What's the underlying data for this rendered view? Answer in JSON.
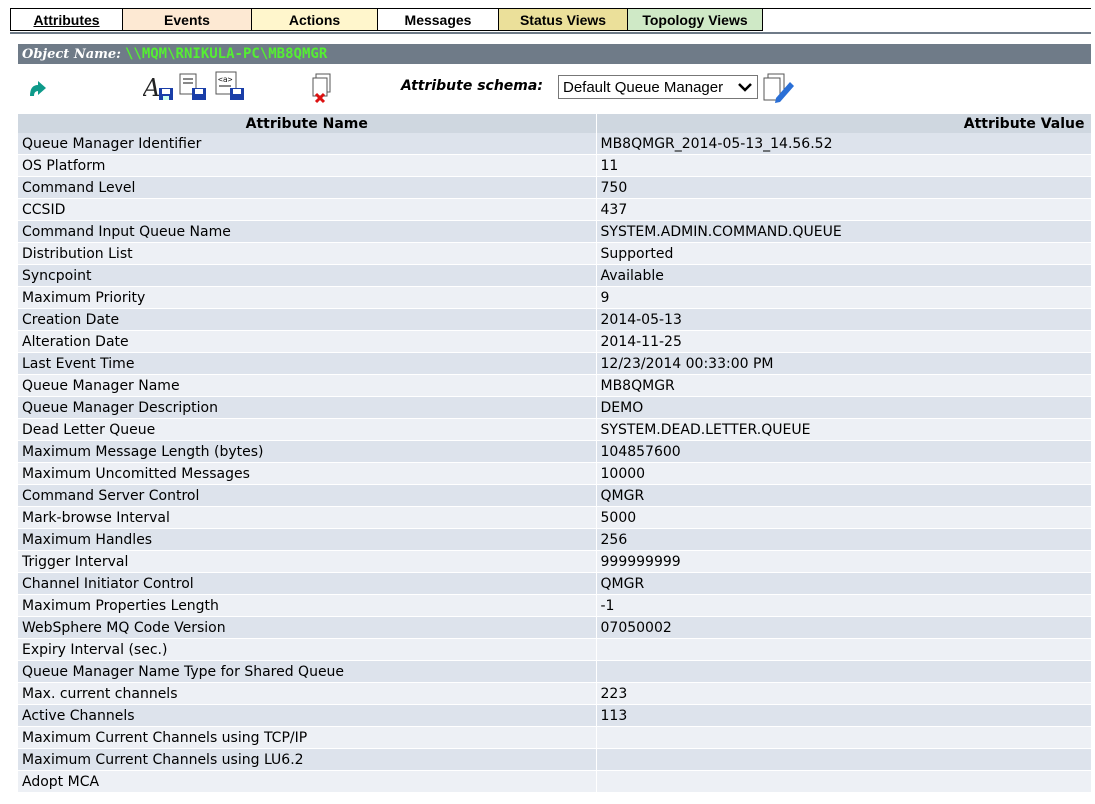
{
  "tabs": [
    {
      "label": "Attributes",
      "bg": "#ffffff",
      "active": true
    },
    {
      "label": "Events",
      "bg": "#fde9d3"
    },
    {
      "label": "Actions",
      "bg": "#fff6cc"
    },
    {
      "label": "Messages",
      "bg": "#ffffff"
    },
    {
      "label": "Status Views",
      "bg": "#ebe09a"
    },
    {
      "label": "Topology Views",
      "bg": "#cfe9c6"
    }
  ],
  "header": {
    "label": "Object Name:",
    "value": "\\\\MQM\\RNIKULA-PC\\MB8QMGR"
  },
  "toolbar": {
    "schema_label": "Attribute schema:",
    "schema_value": "Default Queue Manager",
    "icons": [
      "refresh-icon",
      "font-save-icon",
      "doc-save-icon",
      "xml-save-icon",
      "delete-icon",
      "edit-schema-icon"
    ]
  },
  "table": {
    "headers": {
      "name": "Attribute Name",
      "value": "Attribute Value"
    },
    "rows": [
      {
        "name": "Queue Manager Identifier",
        "value": "MB8QMGR_2014-05-13_14.56.52"
      },
      {
        "name": "OS Platform",
        "value": "11"
      },
      {
        "name": "Command Level",
        "value": "750"
      },
      {
        "name": "CCSID",
        "value": "437"
      },
      {
        "name": "Command Input Queue Name",
        "value": "SYSTEM.ADMIN.COMMAND.QUEUE"
      },
      {
        "name": "Distribution List",
        "value": "Supported"
      },
      {
        "name": "Syncpoint",
        "value": "Available"
      },
      {
        "name": "Maximum Priority",
        "value": "9"
      },
      {
        "name": "Creation Date",
        "value": "2014-05-13"
      },
      {
        "name": "Alteration Date",
        "value": "2014-11-25"
      },
      {
        "name": "Last Event Time",
        "value": "12/23/2014 00:33:00 PM"
      },
      {
        "name": "Queue Manager Name",
        "value": "MB8QMGR"
      },
      {
        "name": "Queue Manager Description",
        "value": "DEMO"
      },
      {
        "name": "Dead Letter Queue",
        "value": "SYSTEM.DEAD.LETTER.QUEUE"
      },
      {
        "name": "Maximum Message Length (bytes)",
        "value": "104857600"
      },
      {
        "name": "Maximum Uncomitted Messages",
        "value": "10000"
      },
      {
        "name": "Command Server Control",
        "value": "QMGR"
      },
      {
        "name": "Mark-browse Interval",
        "value": "5000"
      },
      {
        "name": "Maximum Handles",
        "value": "256"
      },
      {
        "name": "Trigger Interval",
        "value": "999999999"
      },
      {
        "name": "Channel Initiator Control",
        "value": "QMGR"
      },
      {
        "name": "Maximum Properties Length",
        "value": "-1"
      },
      {
        "name": "WebSphere MQ Code Version",
        "value": "07050002"
      },
      {
        "name": "Expiry Interval (sec.)",
        "value": ""
      },
      {
        "name": "Queue Manager Name Type for Shared Queue",
        "value": ""
      },
      {
        "name": "Max. current channels",
        "value": "223"
      },
      {
        "name": "Active Channels",
        "value": "113"
      },
      {
        "name": "Maximum Current Channels using TCP/IP",
        "value": ""
      },
      {
        "name": "Maximum Current Channels using LU6.2",
        "value": ""
      },
      {
        "name": "Adopt MCA",
        "value": ""
      }
    ]
  }
}
